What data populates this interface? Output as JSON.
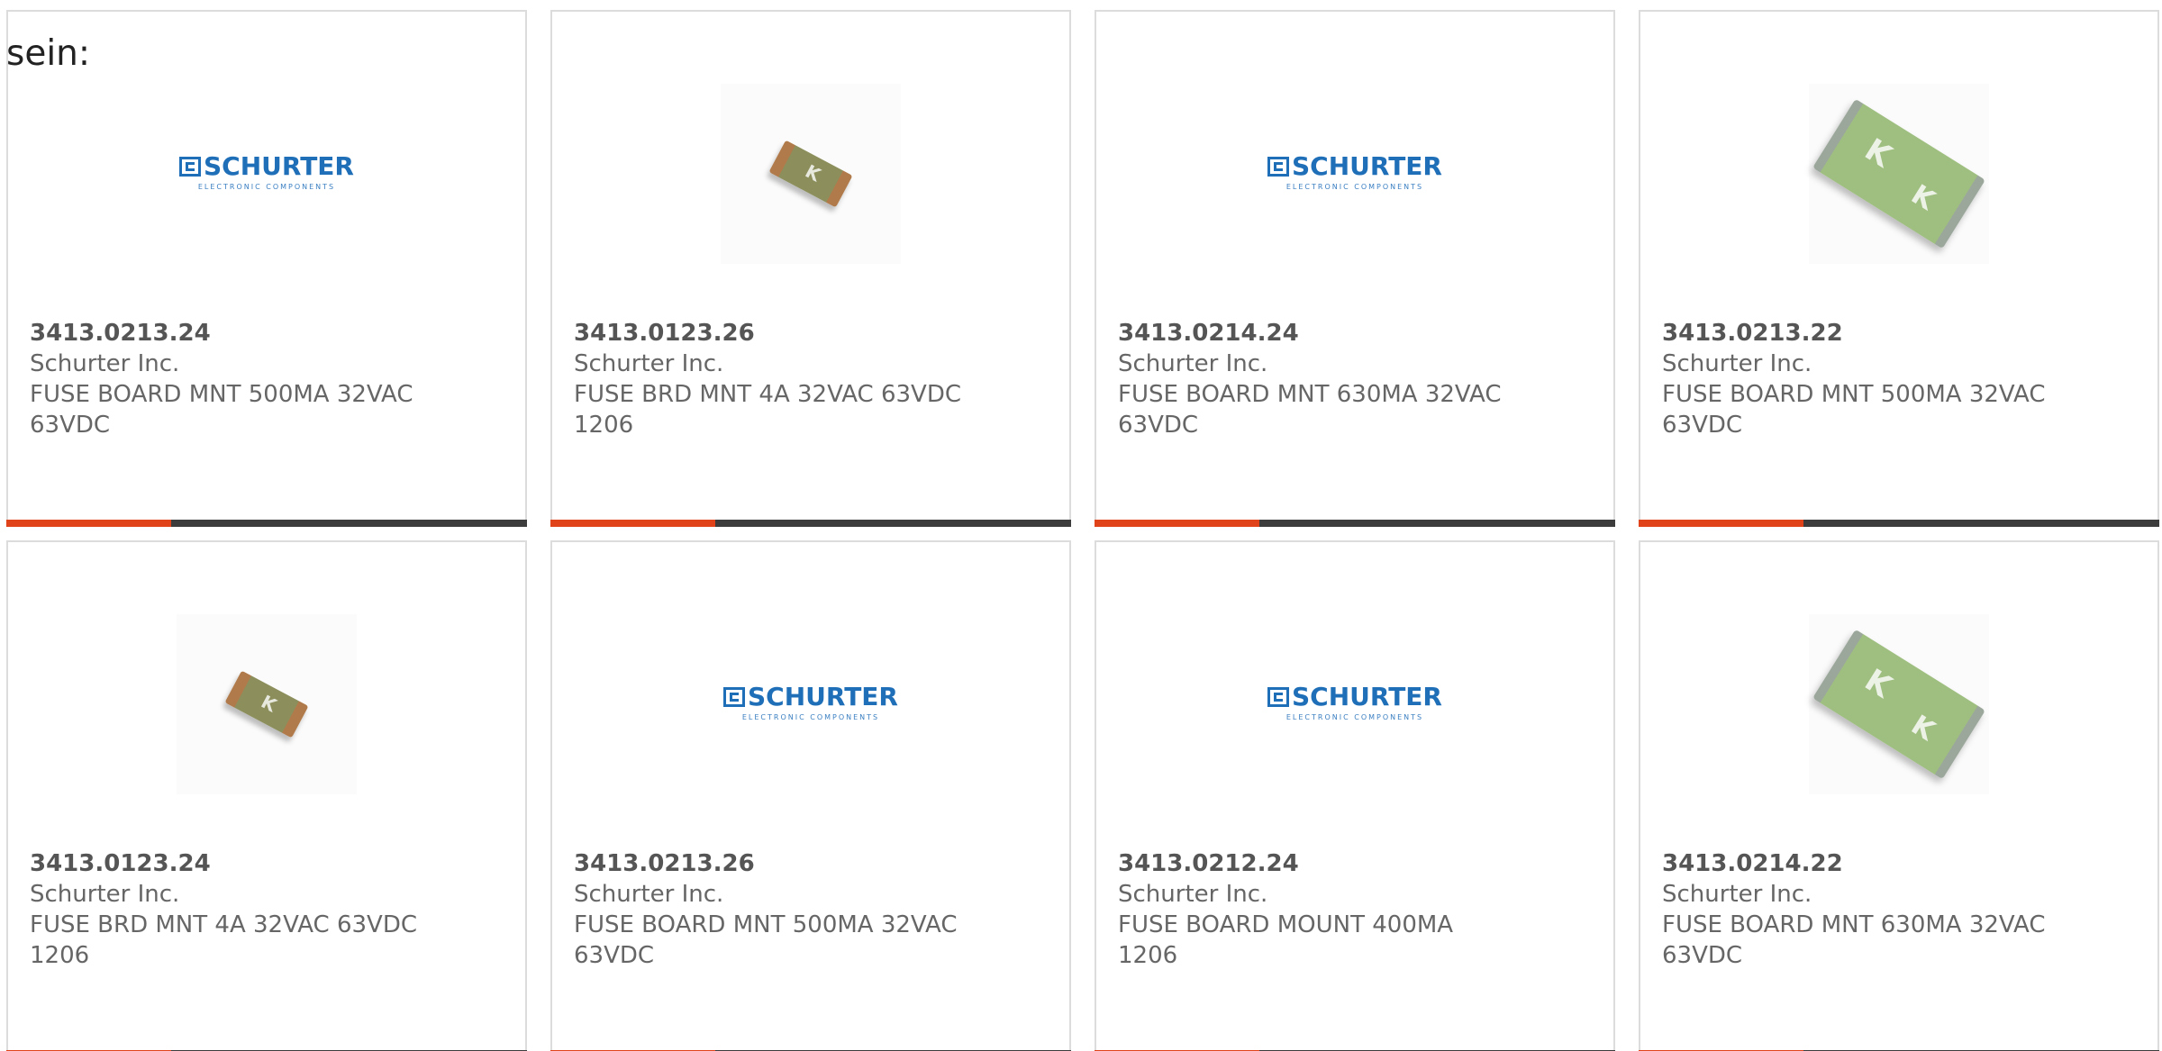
{
  "intro_text": "sein:",
  "logo": {
    "word": "SCHURTER",
    "sub": "ELECTRONIC COMPONENTS"
  },
  "colors": {
    "accent": "#e0421a",
    "bar": "#3c3c3c",
    "logo_blue": "#1f6fb8"
  },
  "cards": [
    {
      "part_number": "3413.0213.24",
      "manufacturer": "Schurter Inc.",
      "description_line1": "FUSE BOARD MNT 500MA 32VAC",
      "description_line2": "63VDC",
      "image": "schurter-logo"
    },
    {
      "part_number": "3413.0123.26",
      "manufacturer": "Schurter Inc.",
      "description_line1": "FUSE BRD MNT 4A 32VAC 63VDC",
      "description_line2": "1206",
      "image": "fuse-chip-small"
    },
    {
      "part_number": "3413.0214.24",
      "manufacturer": "Schurter Inc.",
      "description_line1": "FUSE BOARD MNT 630MA 32VAC",
      "description_line2": "63VDC",
      "image": "schurter-logo"
    },
    {
      "part_number": "3413.0213.22",
      "manufacturer": "Schurter Inc.",
      "description_line1": "FUSE BOARD MNT 500MA 32VAC",
      "description_line2": "63VDC",
      "image": "fuse-chip-large"
    },
    {
      "part_number": "3413.0123.24",
      "manufacturer": "Schurter Inc.",
      "description_line1": "FUSE BRD MNT 4A 32VAC 63VDC",
      "description_line2": "1206",
      "image": "fuse-chip-small"
    },
    {
      "part_number": "3413.0213.26",
      "manufacturer": "Schurter Inc.",
      "description_line1": "FUSE BOARD MNT 500MA 32VAC",
      "description_line2": "63VDC",
      "image": "schurter-logo"
    },
    {
      "part_number": "3413.0212.24",
      "manufacturer": "Schurter Inc.",
      "description_line1": "FUSE BOARD MOUNT 400MA",
      "description_line2": "1206",
      "image": "schurter-logo"
    },
    {
      "part_number": "3413.0214.22",
      "manufacturer": "Schurter Inc.",
      "description_line1": "FUSE BOARD MNT 630MA 32VAC",
      "description_line2": "63VDC",
      "image": "fuse-chip-large"
    }
  ]
}
